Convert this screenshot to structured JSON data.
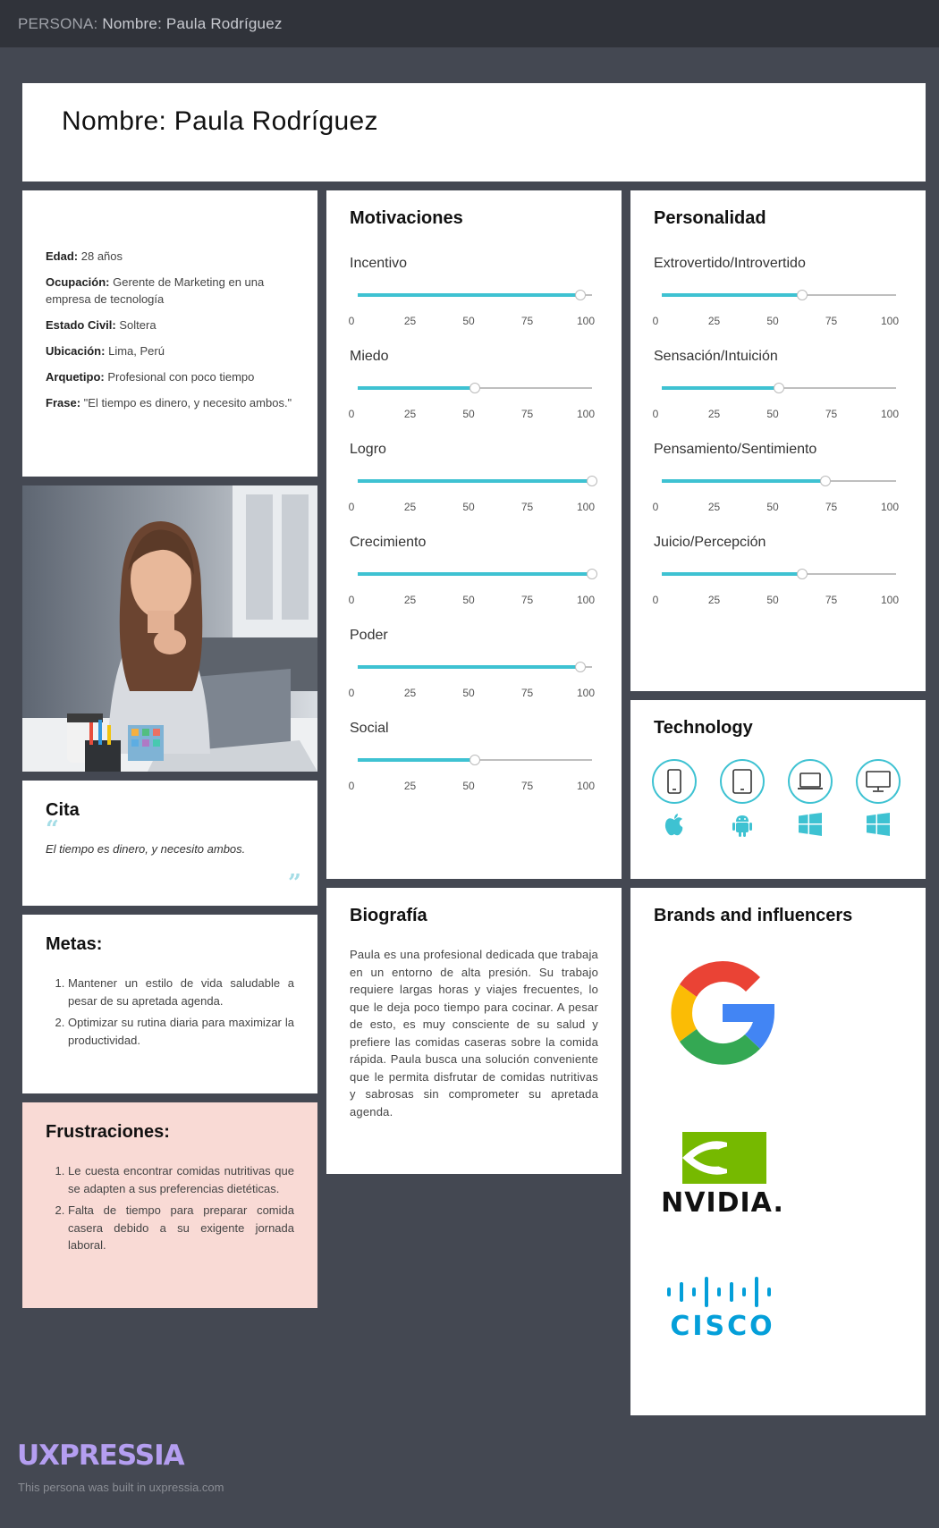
{
  "topbar": {
    "prefix": "PERSONA:",
    "title": "Nombre: Paula Rodríguez"
  },
  "header": {
    "title": "Nombre: Paula Rodríguez"
  },
  "info": [
    {
      "label": "Edad:",
      "value": "28 años"
    },
    {
      "label": "Ocupación:",
      "value": "Gerente de Marketing en una empresa de tecnología"
    },
    {
      "label": "Estado Civil:",
      "value": "Soltera"
    },
    {
      "label": "Ubicación:",
      "value": "Lima, Perú"
    },
    {
      "label": "Arquetipo:",
      "value": "Profesional con poco tiempo"
    },
    {
      "label": "Frase:",
      "value": "\"El tiempo es dinero, y necesito ambos.\""
    }
  ],
  "quote": {
    "title": "Cita",
    "text": "El tiempo es dinero, y necesito ambos."
  },
  "goals": {
    "title": "Metas:",
    "items": [
      "Mantener un estilo de vida saludable a pesar de su apretada agenda.",
      "Optimizar su rutina diaria para maximizar la productividad."
    ]
  },
  "frustrations": {
    "title": "Frustraciones:",
    "items": [
      "Le cuesta encontrar comidas nutritivas que se adapten a sus preferencias dietéticas.",
      "Falta de tiempo para preparar comida casera debido a su exigente jornada laboral."
    ]
  },
  "scale_ticks": [
    "0",
    "25",
    "50",
    "75",
    "100"
  ],
  "motivations": {
    "title": "Motivaciones",
    "items": [
      {
        "label": "Incentivo",
        "value": 95
      },
      {
        "label": "Miedo",
        "value": 50
      },
      {
        "label": "Logro",
        "value": 100
      },
      {
        "label": "Crecimiento",
        "value": 100
      },
      {
        "label": "Poder",
        "value": 95
      },
      {
        "label": "Social",
        "value": 50
      }
    ]
  },
  "personality": {
    "title": "Personalidad",
    "items": [
      {
        "label": "Extrovertido/Introvertido",
        "value": 60
      },
      {
        "label": "Sensación/Intuición",
        "value": 50
      },
      {
        "label": "Pensamiento/Sentimiento",
        "value": 70
      },
      {
        "label": "Juicio/Percepción",
        "value": 60
      }
    ]
  },
  "technology": {
    "title": "Technology",
    "devices": [
      {
        "device": "smartphone-icon",
        "os": "apple-icon"
      },
      {
        "device": "tablet-icon",
        "os": "android-icon"
      },
      {
        "device": "laptop-icon",
        "os": "windows-icon"
      },
      {
        "device": "desktop-icon",
        "os": "windows-icon"
      }
    ]
  },
  "biography": {
    "title": "Biografía",
    "text": "Paula es una profesional dedicada que trabaja en un entorno de alta presión. Su trabajo requiere largas horas y viajes frecuentes, lo que le deja poco tiempo para cocinar. A pesar de esto, es muy consciente de su salud y prefiere las comidas caseras sobre la comida rápida. Paula busca una solución conveniente que le permita disfrutar de comidas nutritivas y sabrosas sin comprometer su apretada agenda."
  },
  "brands": {
    "title": "Brands and influencers",
    "logos": [
      "google-logo",
      "nvidia-logo",
      "cisco-logo"
    ],
    "nvidia_text": "NVIDIA.",
    "cisco_text": "CISCO"
  },
  "footer": {
    "logo": "UXPRESSIA",
    "text": "This persona was built in uxpressia.com"
  },
  "colors": {
    "accent": "#3ec2d2",
    "background": "#444852",
    "topbar": "#30333a",
    "frustrations_bg": "#f9dad5",
    "footer_logo": "#b49ef0"
  }
}
